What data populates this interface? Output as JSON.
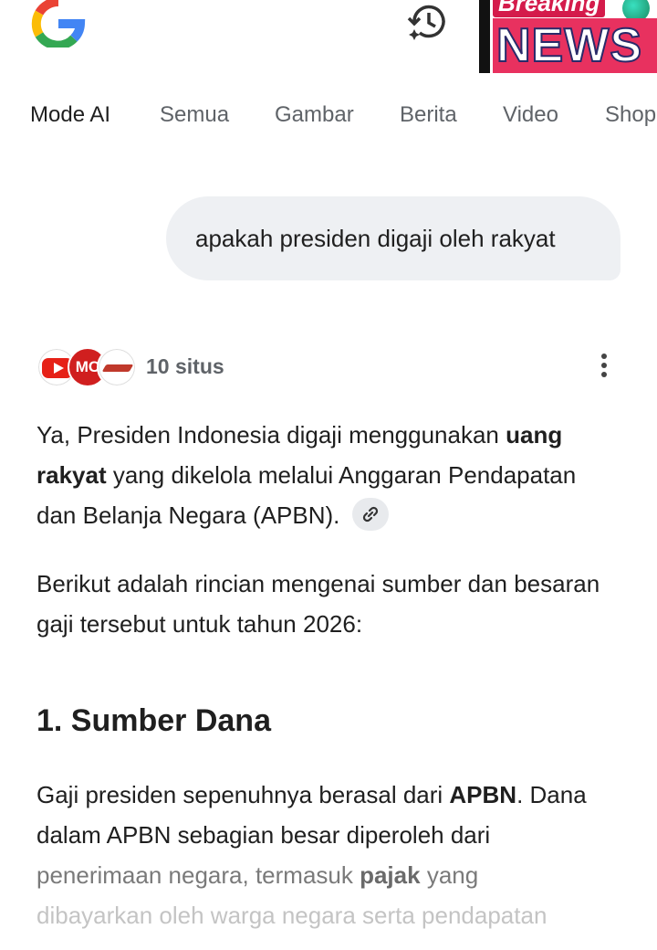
{
  "tabs": [
    "Mode AI",
    "Semua",
    "Gambar",
    "Berita",
    "Video",
    "Shop"
  ],
  "news_badge": {
    "top_text": "Breaking",
    "main_text": "NEWS"
  },
  "query": "apakah presiden digaji oleh rakyat",
  "sources": {
    "label": "10 situs",
    "icons": [
      "youtube-icon",
      "mc-logo",
      "arrow-logo"
    ],
    "mc_text": "MC"
  },
  "answer": {
    "p1": {
      "before": "Ya, Presiden Indonesia digaji menggunakan ",
      "bold": "uang rakyat",
      "after": " yang dikelola melalui Anggaran Pendapatan dan Belanja Negara (APBN)."
    },
    "p2": "Berikut adalah rincian mengenai sumber dan besaran gaji tersebut untuk tahun 2026:",
    "heading": "1. Sumber Dana",
    "p3": {
      "a": "Gaji presiden sepenuhnya berasal dari ",
      "b_bold": "APBN",
      "c": ". Dana dalam APBN sebagian besar diperoleh dari",
      "d": "penerimaan negara, termasuk ",
      "e_bold": "pajak",
      "f": " yang",
      "g": "dibayarkan oleh warga negara serta pendapatan"
    }
  },
  "colors": {
    "accent_red": "#e62117",
    "bubble_bg": "#eef0f3",
    "text": "#1f1f1f",
    "muted": "#5f6368"
  }
}
